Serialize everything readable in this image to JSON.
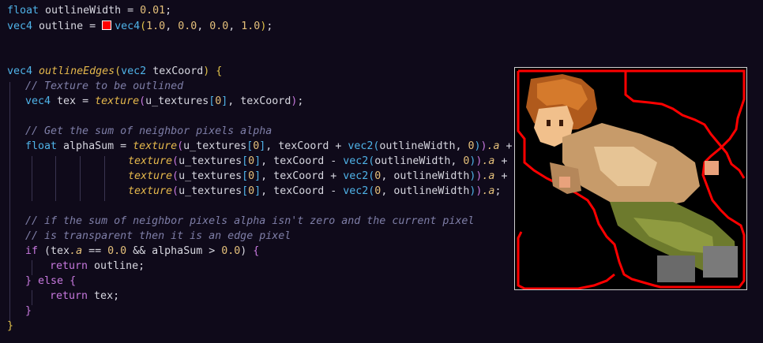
{
  "code": {
    "l1": {
      "type": "float",
      "rest": "outlineWidth = ",
      "val": "0.01",
      "end": ";"
    },
    "l2": {
      "type": "vec4",
      "rest": "outline = ",
      "ctor": "vec4",
      "open": "(",
      "a": "1.0",
      "c1": ", ",
      "b": "0.0",
      "c2": ", ",
      "c": "0.0",
      "c3": ", ",
      "d": "1.0",
      "close": ")",
      "end": ";"
    },
    "l5": {
      "type": "vec4",
      "fn": "outlineEdges",
      "open": "(",
      "ptype": "vec2",
      "param": "texCoord",
      "close": ")",
      "brace": "{"
    },
    "l6": {
      "comment": "// Texture to be outlined"
    },
    "l7": {
      "type": "vec4",
      "rest": "tex = ",
      "fn": "texture",
      "open": "(",
      "arg1": "u_textures",
      "lb": "[",
      "idx": "0",
      "rb": "]",
      "arg2": ", texCoord",
      "close": ")",
      "end": ";"
    },
    "l9": {
      "comment": "// Get the sum of neighbor pixels alpha"
    },
    "l10": {
      "type": "float",
      "rest": "alphaSum = ",
      "fn": "texture",
      "open": "(",
      "arg1": "u_textures",
      "lb": "[",
      "idx": "0",
      "rb": "]",
      "arg2": ", texCoord + ",
      "ctor": "vec2",
      "vopen": "(",
      "varg1": "outlineWidth, ",
      "varg2": "0",
      "vclose": ")",
      "close": ")",
      "prop": ".a",
      "tail": " +"
    },
    "l11": {
      "fn": "texture",
      "open": "(",
      "arg1": "u_textures",
      "lb": "[",
      "idx": "0",
      "rb": "]",
      "arg2": ", texCoord - ",
      "ctor": "vec2",
      "vopen": "(",
      "varg1": "outlineWidth, ",
      "varg2": "0",
      "vclose": ")",
      "close": ")",
      "prop": ".a",
      "tail": " +"
    },
    "l12": {
      "fn": "texture",
      "open": "(",
      "arg1": "u_textures",
      "lb": "[",
      "idx": "0",
      "rb": "]",
      "arg2": ", texCoord + ",
      "ctor": "vec2",
      "vopen": "(",
      "varg1": "0",
      "varg2": ", outlineWidth",
      "vclose": ")",
      "close": ")",
      "prop": ".a",
      "tail": " +"
    },
    "l13": {
      "fn": "texture",
      "open": "(",
      "arg1": "u_textures",
      "lb": "[",
      "idx": "0",
      "rb": "]",
      "arg2": ", texCoord - ",
      "ctor": "vec2",
      "vopen": "(",
      "varg1": "0",
      "varg2": ", outlineWidth",
      "vclose": ")",
      "close": ")",
      "prop": ".a",
      "tail": ";"
    },
    "l15": {
      "comment": "// if the sum of neighbor pixels alpha isn't zero and the current pixel"
    },
    "l16": {
      "comment": "// is transparent then it is an edge pixel"
    },
    "l17": {
      "kw": "if",
      "open": " (",
      "var": "tex",
      "prop": ".a",
      "mid": " == ",
      "num": "0.0",
      "mid2": " && alphaSum > ",
      "num2": "0.0",
      "close": ") ",
      "brace": "{"
    },
    "l18": {
      "kw": "return",
      "rest": " outline;"
    },
    "l19": {
      "brace": "}",
      "kw": "else",
      "brace2": "{"
    },
    "l20": {
      "kw": "return",
      "rest": " tex;"
    },
    "l21": {
      "brace": "}"
    },
    "l22": {
      "brace": "}"
    }
  },
  "preview": {
    "outline_color": "#ff0000",
    "description_icon": "pixel-art-character-sprite"
  }
}
